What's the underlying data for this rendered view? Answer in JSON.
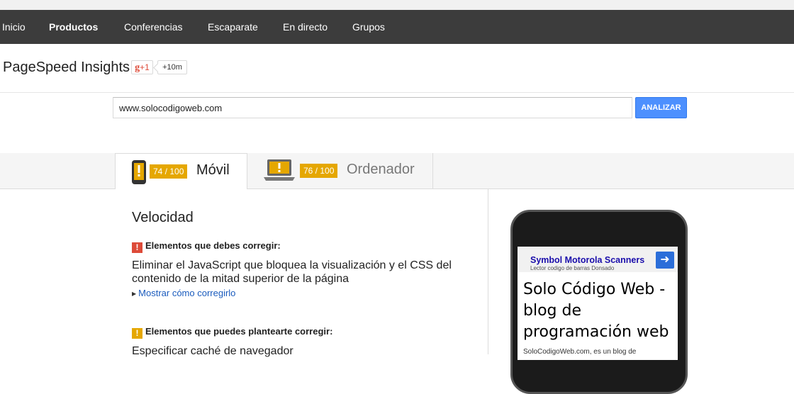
{
  "nav": {
    "items": [
      {
        "label": "Inicio"
      },
      {
        "label": "Productos"
      },
      {
        "label": "Conferencias"
      },
      {
        "label": "Escaparate"
      },
      {
        "label": "En directo"
      },
      {
        "label": "Grupos"
      }
    ]
  },
  "header": {
    "title": "PageSpeed Insights",
    "gplus_label": "+1",
    "gplus_g": "g",
    "gplus_count": "+10m"
  },
  "search": {
    "value": "www.solocodigoweb.com",
    "button_label": "ANALIZAR"
  },
  "tabs": [
    {
      "label": "Móvil",
      "score": "74 / 100",
      "icon": "phone-warning-icon"
    },
    {
      "label": "Ordenador",
      "score": "76 / 100",
      "icon": "laptop-warning-icon"
    }
  ],
  "results": {
    "section_title": "Velocidad",
    "must_fix": {
      "heading": "Elementos que debes corregir:",
      "rule": "Eliminar el JavaScript que bloquea la visualización y el CSS del contenido de la mitad superior de la página",
      "link": "Mostrar cómo corregirlo"
    },
    "consider_fix": {
      "heading": "Elementos que puedes plantearte corregir:",
      "rule": "Especificar caché de navegador"
    }
  },
  "preview": {
    "ad_title": "Symbol Motorola Scanners",
    "ad_subtitle": "Lector codigo de barras Donsado",
    "site_title": "Solo Código Web - blog de programación web",
    "site_desc": "SoloCodigoWeb.com, es un blog de"
  },
  "colors": {
    "nav_bg": "#3c3c3c",
    "score_warning": "#e5a700",
    "error_red": "#dd4b39",
    "button_blue": "#4d90fe",
    "link_blue": "#1a5bbd"
  }
}
